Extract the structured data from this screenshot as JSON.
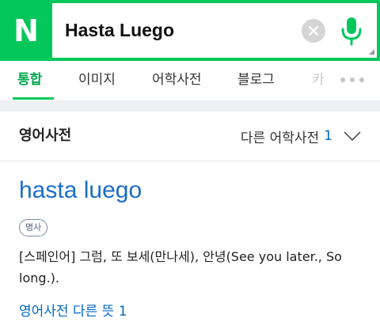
{
  "search": {
    "logo": "N",
    "query": "Hasta Luego",
    "clear_icon": "close-icon",
    "mic_icon": "mic-icon",
    "brand_color": "#03c75a"
  },
  "tabs": [
    {
      "label": "통합",
      "active": true
    },
    {
      "label": "이미지"
    },
    {
      "label": "어학사전"
    },
    {
      "label": "블로그"
    },
    {
      "label": "카"
    }
  ],
  "dictionary": {
    "title": "영어사전",
    "other_dicts_label": "다른 어학사전",
    "other_dicts_count": "1",
    "entry": {
      "word": "hasta luego",
      "part_of_speech": "명사",
      "meaning": "[스페인어] 그럼, 또 보세(만나세), 안녕(See you later., So long.).",
      "more_link": "영어사전 다른 뜻 1"
    },
    "link_color": "#0068c3"
  }
}
